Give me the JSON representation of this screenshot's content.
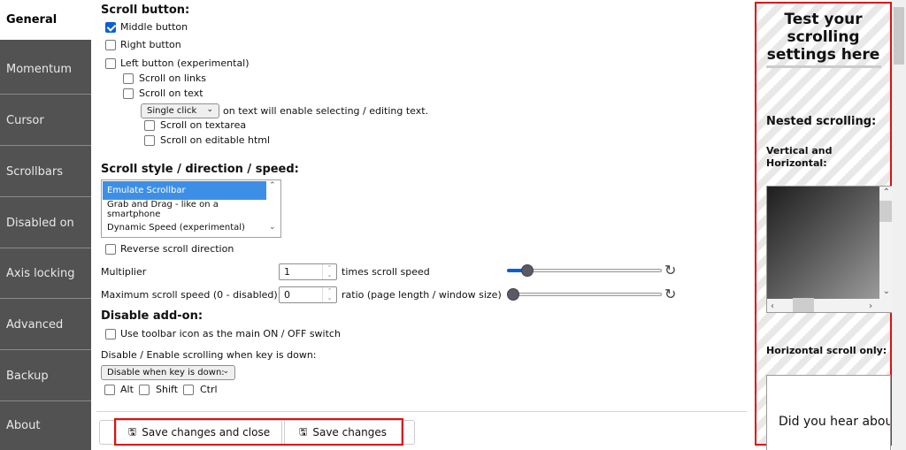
{
  "sidebar": {
    "items": [
      {
        "label": "General",
        "active": true
      },
      {
        "label": "Momentum"
      },
      {
        "label": "Cursor"
      },
      {
        "label": "Scrollbars"
      },
      {
        "label": "Disabled on"
      },
      {
        "label": "Axis locking"
      },
      {
        "label": "Advanced"
      },
      {
        "label": "Backup"
      },
      {
        "label": "About"
      }
    ]
  },
  "scroll_button": {
    "heading": "Scroll button:",
    "middle_button": {
      "label": "Middle button",
      "checked": true
    },
    "right_button": {
      "label": "Right button",
      "checked": false
    },
    "left_button": {
      "label": "Left button (experimental)",
      "checked": false
    },
    "scroll_on_links": {
      "label": "Scroll on links",
      "checked": false
    },
    "scroll_on_text": {
      "label": "Scroll on text",
      "checked": false
    },
    "click_select": {
      "value": "Single click",
      "suffix": "on text will enable selecting / editing text."
    },
    "scroll_on_textarea": {
      "label": "Scroll on textarea",
      "checked": false
    },
    "scroll_on_editable": {
      "label": "Scroll on editable html",
      "checked": false
    }
  },
  "scroll_style": {
    "heading": "Scroll style / direction / speed:",
    "options": [
      "Emulate Scrollbar",
      "Grab and Drag - like on a smartphone",
      "Dynamic Speed (experimental)"
    ],
    "selected": "Emulate Scrollbar",
    "reverse": {
      "label": "Reverse scroll direction",
      "checked": false
    },
    "multiplier": {
      "label": "Multiplier",
      "value": "1",
      "suffix": "times scroll speed",
      "slider_fraction": 0.1
    },
    "max_speed": {
      "label": "Maximum scroll speed (0 - disabled):",
      "value": "0",
      "suffix": "ratio (page length / window size)",
      "slider_fraction": 0
    }
  },
  "disable_addon": {
    "heading": "Disable add-on:",
    "toolbar_switch": {
      "label": "Use toolbar icon as the main ON / OFF switch",
      "checked": false
    },
    "key_label": "Disable / Enable scrolling when key is down:",
    "key_mode": "Disable when key is down:",
    "keys": [
      {
        "label": "Alt",
        "checked": false
      },
      {
        "label": "Shift",
        "checked": false
      },
      {
        "label": "Ctrl",
        "checked": false
      }
    ]
  },
  "actions": {
    "save_close": "Save changes and close",
    "save": "Save changes"
  },
  "test_panel": {
    "title": "Test your scrolling settings here",
    "nested_heading": "Nested scrolling:",
    "vh_heading": "Vertical and Horizontal:",
    "h_heading": "Horizontal scroll only:",
    "h_text": "Did you hear about"
  },
  "colors": {
    "accent": "#0b5fd6",
    "highlight": "#e01010",
    "sidebar_bg": "#525252"
  }
}
